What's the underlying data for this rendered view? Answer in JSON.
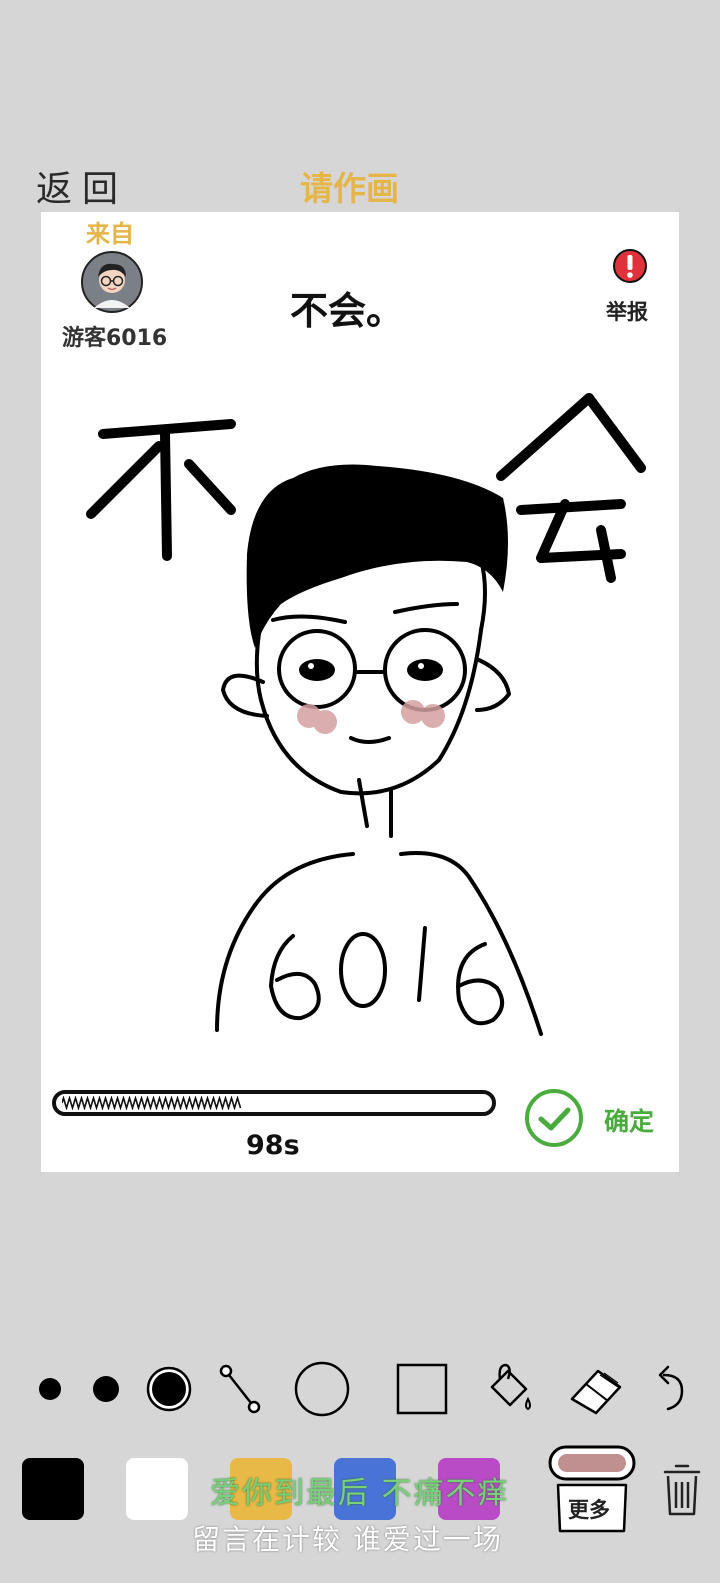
{
  "header": {
    "back_label": "返回",
    "title": "请作画"
  },
  "card": {
    "from_label": "来自",
    "username": "游客6016",
    "prompt": "不会。",
    "report_label": "举报"
  },
  "timer": {
    "text": "98s",
    "remaining_fraction": 0.38
  },
  "confirm_label": "确定",
  "drawing_text": {
    "left": "不",
    "right": "会",
    "shirt": "6016"
  },
  "tools": [
    "brush-small",
    "brush-medium",
    "brush-large",
    "line-tool",
    "circle-tool",
    "rect-tool",
    "fill-bucket",
    "eraser",
    "undo"
  ],
  "colors": {
    "accent": "#e5b547",
    "confirm": "#4aac3e",
    "report": "#e0323a",
    "palette": [
      "#000000",
      "#ffffff",
      "#e8b947",
      "#4a73d8",
      "#b94bc7"
    ],
    "current_brush": "#c09090"
  },
  "more_label": "更多",
  "lyrics": {
    "line1": "爱你到最后 不痛不痒",
    "line2": "留言在计较 谁爱过一场"
  }
}
